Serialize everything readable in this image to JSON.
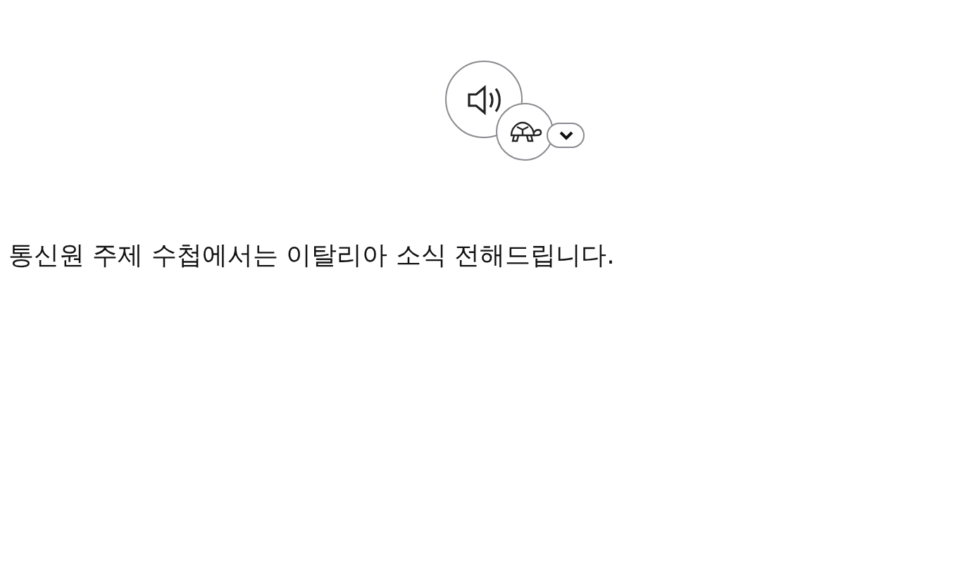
{
  "sentence": "통신원 주제 수첩에서는 이탈리아 소식 전해드립니다."
}
